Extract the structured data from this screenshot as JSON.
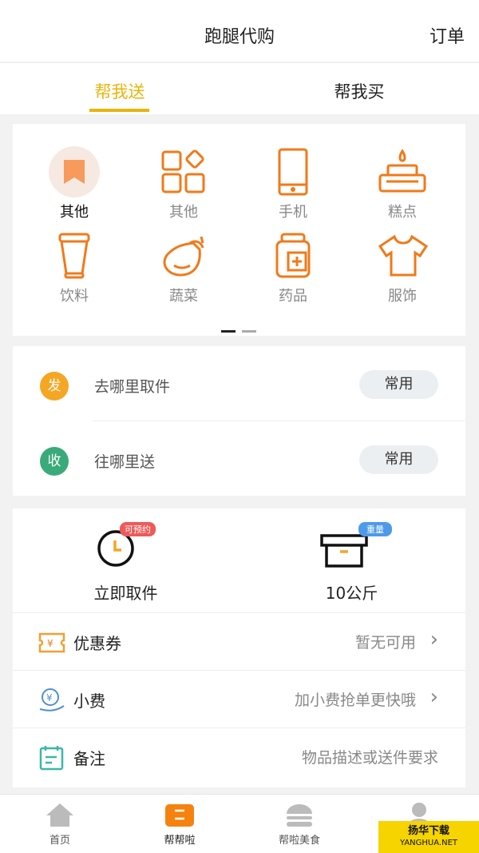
{
  "header": {
    "title": "跑腿代购",
    "orders": "订单"
  },
  "tabs": [
    "帮我送",
    "帮我买"
  ],
  "categories": [
    {
      "label": "其他",
      "icon": "bookmark-icon",
      "selected": true
    },
    {
      "label": "其他",
      "icon": "grid-icon"
    },
    {
      "label": "手机",
      "icon": "phone-icon"
    },
    {
      "label": "糕点",
      "icon": "cake-icon"
    },
    {
      "label": "饮料",
      "icon": "drink-icon"
    },
    {
      "label": "蔬菜",
      "icon": "eggplant-icon"
    },
    {
      "label": "药品",
      "icon": "medicine-icon"
    },
    {
      "label": "服饰",
      "icon": "shirt-icon"
    }
  ],
  "address": {
    "pickup": {
      "badge": "发",
      "placeholder": "去哪里取件",
      "button": "常用",
      "color": "#f5a623"
    },
    "delivery": {
      "badge": "收",
      "placeholder": "往哪里送",
      "button": "常用",
      "color": "#3aaa7a"
    }
  },
  "options": {
    "time": {
      "label": "立即取件",
      "badge": "可预约"
    },
    "weight": {
      "label": "10公斤",
      "badge": "重量"
    }
  },
  "rows": [
    {
      "label": "优惠券",
      "value": "暂无可用"
    },
    {
      "label": "小费",
      "value": "加小费抢单更快哦"
    },
    {
      "label": "备注",
      "value": "物品描述或送件要求"
    }
  ],
  "nav": [
    "首页",
    "帮帮啦",
    "帮啦美食"
  ],
  "watermark": {
    "name": "扬华下载",
    "url": "YANGHUA.NET"
  },
  "colors": {
    "accent": "#e8b50c",
    "orange": "#f07a1a"
  }
}
